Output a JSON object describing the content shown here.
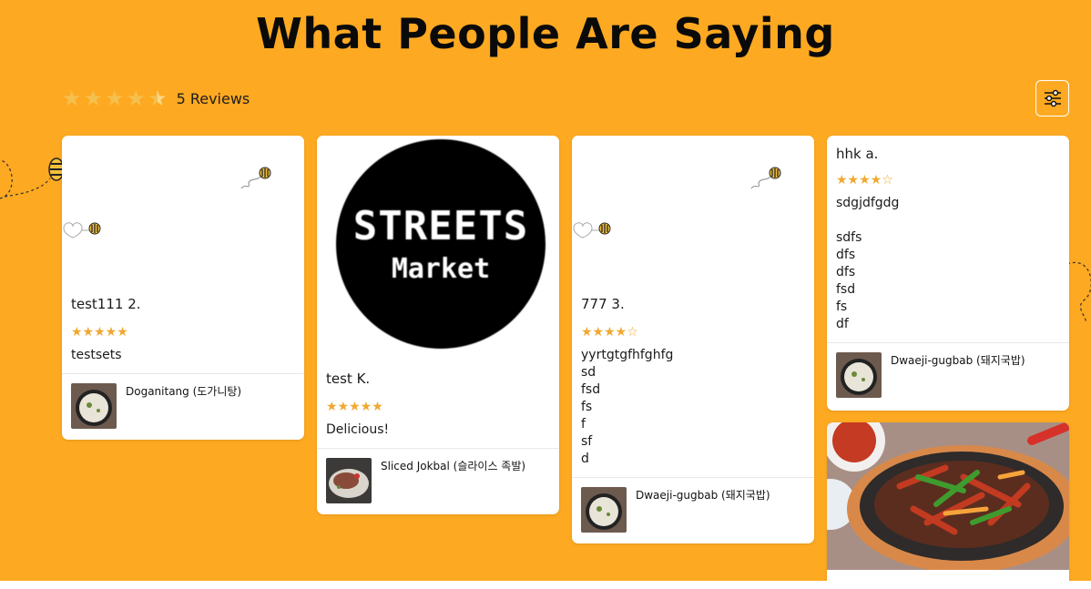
{
  "section": {
    "title": "What People Are Saying",
    "background": "#fda921",
    "star_color": "#f0a830"
  },
  "summary": {
    "average_rating": 4.5,
    "stars_display": [
      "★",
      "★",
      "★",
      "★",
      "★"
    ],
    "review_count_label": "5 Reviews"
  },
  "filter": {
    "icon": "sliders-icon"
  },
  "reviews": [
    {
      "reviewer": "test111 2.",
      "rating": 5,
      "stars": "★★★★★",
      "text": "testsets",
      "product": "Doganitang (도가니탕)",
      "product_thumb": "bowl-soup-image"
    },
    {
      "reviewer": "test K.",
      "rating": 5,
      "stars": "★★★★★",
      "text": "Delicious!",
      "logo_line1": "STREETS",
      "logo_line2": "Market",
      "product": "Sliced Jokbal (슬라이스 족발)",
      "product_thumb": "jokbal-plate-image"
    },
    {
      "reviewer": "777 3.",
      "rating": 4,
      "stars": "★★★★☆",
      "text": "yyrtgtgfhfghfg\nsd\nfsd\nfs\nf\nsf\nd",
      "product": "Dwaeji-gugbab (돼지국밥)",
      "product_thumb": "bowl-soup-image"
    },
    {
      "reviewer": "hhk a.",
      "rating": 4,
      "stars": "★★★★☆",
      "text": "sdgjdfgdg\n\nsdfs\ndfs\ndfs\nfsd\nfs\ndf",
      "product": "Dwaeji-gugbab (돼지국밥)",
      "product_thumb": "bowl-soup-image"
    },
    {
      "media": "bulgogi-skillet-image"
    }
  ]
}
